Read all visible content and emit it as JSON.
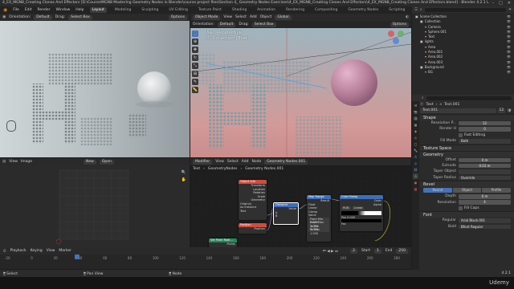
{
  "window": {
    "title": "4_EX_MGN8_Creating Clones And Effectors [D:\\Course\\MGN8 Mastering Geometry Nodes in Blender\\course project files\\Section 4_ Geometry Nodes Exercises\\4_EX_MGN8_Creating Clones And Effectors\\4_EX_MGN8_Creating Clones And Effectors.blend] - Blender 4.2.1 L"
  },
  "menubar": {
    "items": [
      "File",
      "Edit",
      "Render",
      "Window",
      "Help"
    ],
    "workspaces": [
      "Layout",
      "Modeling",
      "Sculpting",
      "UV Editing",
      "Texture Paint",
      "Shading",
      "Animation",
      "Rendering",
      "Compositing",
      "Geometry Nodes",
      "Scripting"
    ],
    "active_workspace": "Layout",
    "scene_label": "Scene",
    "viewlayer_label": "ViewLayer"
  },
  "viewport_left": {
    "orientation_label": "Orientation:",
    "orientation_value": "Default",
    "drag_label": "Drag:",
    "drag_value": "Select Box",
    "options_label": "Options"
  },
  "viewport_right": {
    "mode": "Object Mode",
    "menus": [
      "View",
      "Select",
      "Add",
      "Object"
    ],
    "transform": "Global",
    "orientation_label": "Orientation:",
    "orientation_value": "Default",
    "drag_label": "Drag:",
    "drag_value": "Select Box",
    "options_label": "Options",
    "overlay_line1": "User Perspective",
    "overlay_line2": "(0) Collection | Text"
  },
  "image_editor": {
    "menus": [
      "View",
      "Image"
    ],
    "new_label": "New",
    "open_label": "Open"
  },
  "node_editor": {
    "editor": "Modifier",
    "menus": [
      "View",
      "Select",
      "Add",
      "Node"
    ],
    "breadcrumb": [
      "Text",
      "GeometryNodes",
      "Geometry Nodes.001"
    ],
    "nodes": {
      "object_info": {
        "title": "Object Info",
        "rows": [
          "Transform",
          "Location",
          "Rotation",
          "Scale",
          "Geometry",
          "Original",
          "As Instance",
          "Text"
        ]
      },
      "position": {
        "title": "Position",
        "rows": [
          "Position"
        ]
      },
      "distance": {
        "title": "Distance",
        "rows": [
          "Value",
          "A",
          "B"
        ]
      },
      "map_range": {
        "title": "Map Range",
        "rows": [
          "Result",
          "Float",
          "Linear",
          "Clamp",
          "Value",
          "From Min 0.000",
          "From Max 1.000",
          "To Min 0.000",
          "To Max 1.000"
        ]
      },
      "color_ramp": {
        "title": "Color Ramp",
        "rows": [
          "Color",
          "Alpha",
          "RGB",
          "Linear",
          "Pos 0.000",
          "Fac"
        ]
      },
      "set_point_radius": {
        "title": "Set Point Radi...",
        "rows": [
          "Points"
        ]
      }
    }
  },
  "outliner": {
    "items": [
      {
        "name": "Scene Collection",
        "depth": 0,
        "color": "#cfcfcf"
      },
      {
        "name": "Collection",
        "depth": 1,
        "color": "#cfcfcf"
      },
      {
        "name": "Camera",
        "depth": 2,
        "color": "#e5a57a"
      },
      {
        "name": "Sphere.001",
        "depth": 2,
        "color": "#e5a57a"
      },
      {
        "name": "Text",
        "depth": 2,
        "color": "#e5a57a"
      },
      {
        "name": "lights",
        "depth": 1,
        "color": "#cfcfcf"
      },
      {
        "name": "Area",
        "depth": 2,
        "color": "#e5a57a"
      },
      {
        "name": "Area.001",
        "depth": 2,
        "color": "#e5a57a"
      },
      {
        "name": "Area.002",
        "depth": 2,
        "color": "#e5a57a"
      },
      {
        "name": "Area.003",
        "depth": 2,
        "color": "#e5a57a"
      },
      {
        "name": "Background",
        "depth": 1,
        "color": "#cfcfcf"
      },
      {
        "name": "BG",
        "depth": 2,
        "color": "#e5a57a"
      }
    ]
  },
  "properties": {
    "breadcrumb_obj": "Text",
    "breadcrumb_data": "Text.001",
    "datablock": "Text.001",
    "datablock_users": "12",
    "shape_section": "Shape",
    "resolution_preview_label": "Resolution P...",
    "resolution_preview_value": "12",
    "render_u_label": "Render U",
    "render_u_value": "0",
    "fast_editing_label": "Fast Editing",
    "fill_mode_label": "Fill Mode",
    "fill_mode_value": "Both",
    "texture_space_section": "Texture Space",
    "geometry_section": "Geometry",
    "offset_label": "Offset",
    "offset_value": "0 m",
    "extrude_label": "Extrude",
    "extrude_value": "0.03 m",
    "taper_object_label": "Taper Object",
    "taper_radius_label": "Taper Radius",
    "taper_radius_value": "Override",
    "bevel_section": "Bevel",
    "bevel_tabs": [
      "Round",
      "Object",
      "Profile"
    ],
    "depth_label": "Depth",
    "depth_value": "0 m",
    "resolution_label": "Resolution",
    "resolution_value": "4",
    "fill_caps_label": "Fill Caps",
    "font_section": "Font",
    "regular_label": "Regular",
    "regular_value": "Arial Black.001",
    "bold_label": "Bold",
    "bold_value": "Bfont Regular"
  },
  "timeline": {
    "menus": [
      "Playback",
      "Keying",
      "View",
      "Marker"
    ],
    "current_frame": "2",
    "start_label": "Start",
    "start_value": "1",
    "end_label": "End",
    "end_value": "250",
    "ticks": [
      "-20",
      "0",
      "20",
      "40",
      "60",
      "80",
      "100",
      "120",
      "140",
      "160",
      "180",
      "200",
      "220",
      "240",
      "260",
      "280"
    ]
  },
  "statusbar": {
    "items": [
      "Select",
      "Pan View",
      "Node"
    ],
    "version": "4.2.1"
  },
  "watermark": "Udemy"
}
